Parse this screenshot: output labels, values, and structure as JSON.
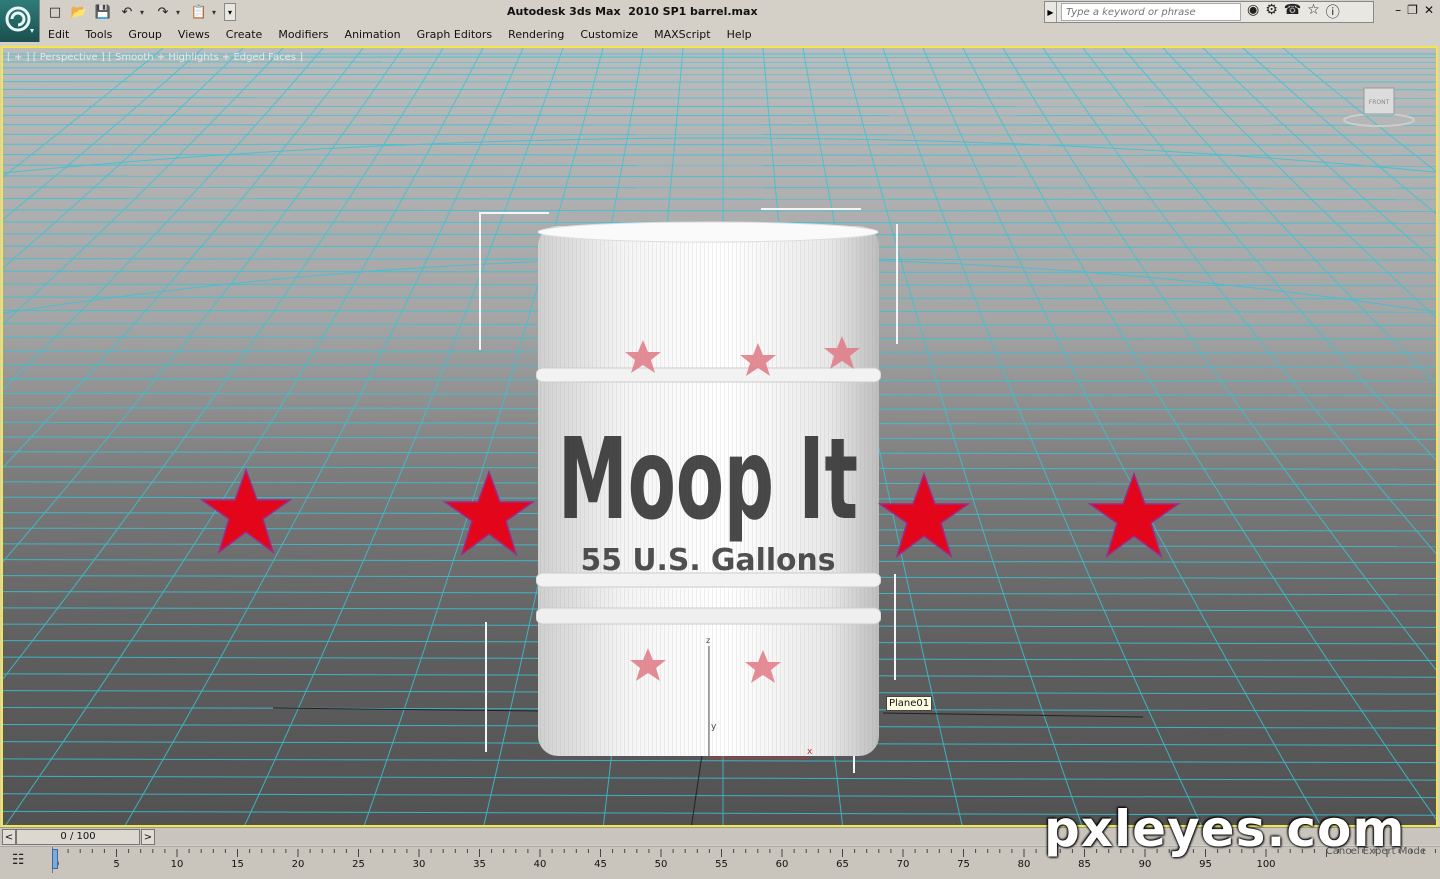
{
  "titlebar": {
    "app_title": "Autodesk 3ds Max  2010 SP1",
    "file_name": "barrel.max",
    "search_placeholder": "Type a keyword or phrase"
  },
  "quick_access": [
    "new-icon",
    "open-icon",
    "save-icon",
    "undo-icon",
    "redo-icon",
    "project-folder-icon"
  ],
  "menu": [
    "Edit",
    "Tools",
    "Group",
    "Views",
    "Create",
    "Modifiers",
    "Animation",
    "Graph Editors",
    "Rendering",
    "Customize",
    "MAXScript",
    "Help"
  ],
  "viewport": {
    "label": "[ + ] [ Perspective ] [ Smooth + Highlights + Edged Faces ]",
    "viewcube_face": "FRONT",
    "tooltip": "Plane01",
    "barrel_text_main": "Moop It",
    "barrel_text_sub": "55 U.S. Gallons",
    "axis_labels": {
      "x": "x",
      "y": "y",
      "z": "z"
    },
    "colors": {
      "grid": "#3ac2d6",
      "star": "#e3061b",
      "border": "#f2e64b"
    }
  },
  "timeline": {
    "frame_display": "0 / 100",
    "prev_label": "<",
    "next_label": ">",
    "ticks": [
      "0",
      "5",
      "10",
      "15",
      "20",
      "25",
      "30",
      "35",
      "40",
      "45",
      "50",
      "55",
      "60",
      "65",
      "70",
      "75",
      "80",
      "85",
      "90",
      "95",
      "100"
    ],
    "mode_text": "Cancel Expert Mode"
  },
  "watermark": "pxleyes.com"
}
